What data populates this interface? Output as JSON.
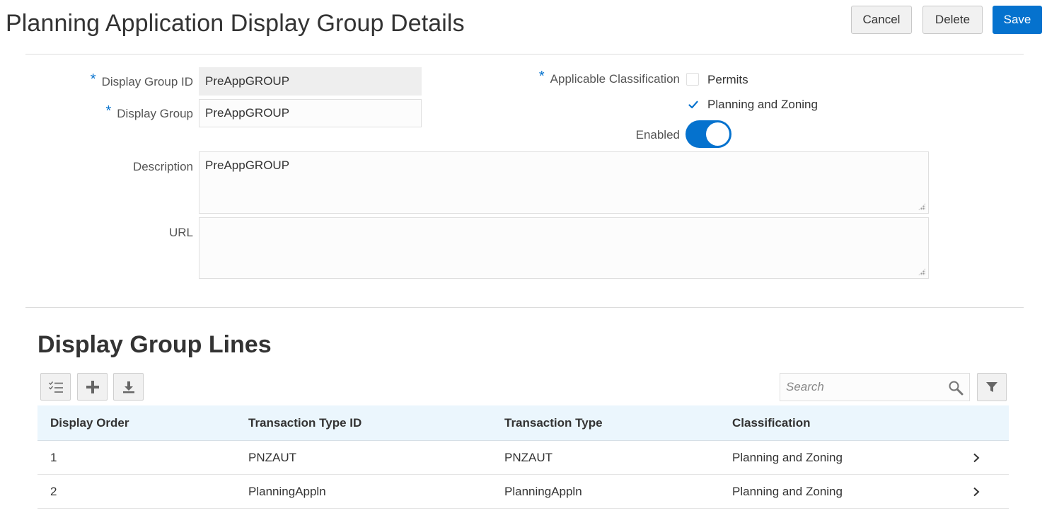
{
  "header": {
    "title": "Planning Application Display Group Details",
    "cancel_label": "Cancel",
    "delete_label": "Delete",
    "save_label": "Save"
  },
  "form": {
    "display_group_id_label": "Display Group ID",
    "display_group_id_value": "PreAppGROUP",
    "display_group_label": "Display Group",
    "display_group_value": "PreAppGROUP",
    "description_label": "Description",
    "description_value": "PreAppGROUP",
    "url_label": "URL",
    "url_value": "",
    "required_marker": "*",
    "applicable_classification_label": "Applicable Classification",
    "classifications": [
      {
        "label": "Permits",
        "checked": false
      },
      {
        "label": "Planning and Zoning",
        "checked": true
      }
    ],
    "enabled_label": "Enabled",
    "enabled": true
  },
  "lines": {
    "title": "Display Group Lines",
    "search_placeholder": "Search",
    "columns": [
      "Display Order",
      "Transaction Type ID",
      "Transaction Type",
      "Classification"
    ],
    "rows": [
      {
        "order": "1",
        "type_id": "PNZAUT",
        "type": "PNZAUT",
        "classification": "Planning and Zoning"
      },
      {
        "order": "2",
        "type_id": "PlanningAppln",
        "type": "PlanningAppln",
        "classification": "Planning and Zoning"
      }
    ]
  },
  "icons": {
    "toolbar": [
      "column-select-icon",
      "add-icon",
      "download-icon"
    ],
    "search": "search-icon",
    "filter": "filter-icon",
    "row": "chevron-right-icon"
  },
  "colors": {
    "accent": "#0572ce",
    "table_header_bg": "#ebf6fd"
  }
}
